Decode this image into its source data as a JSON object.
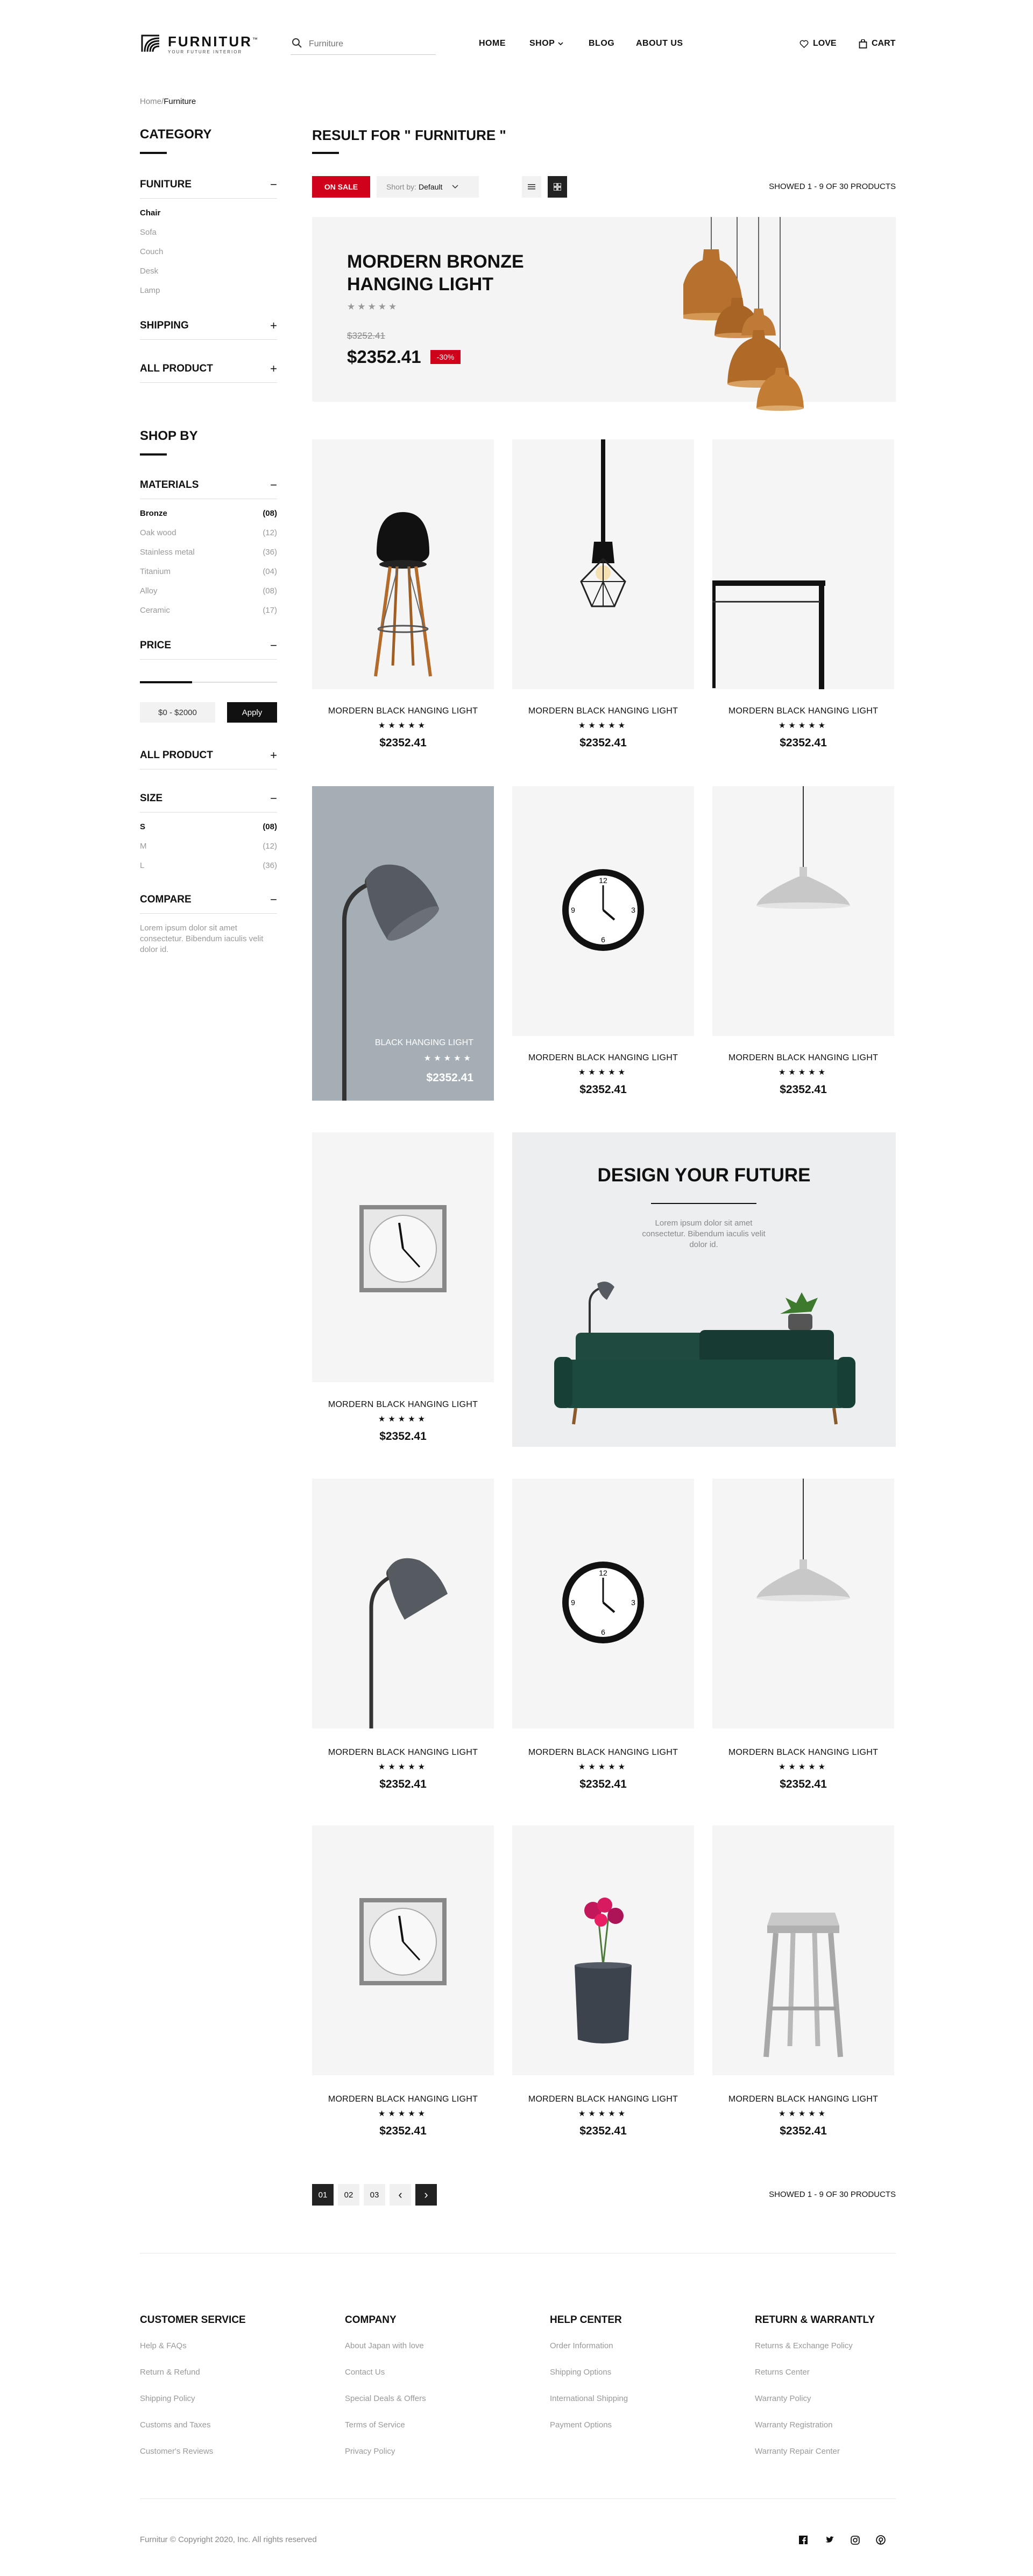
{
  "header": {
    "brand": "FURNITUR",
    "brand_mark": "™",
    "tagline": "YOUR FUTURE INTERIOR",
    "search_placeholder": "Furniture",
    "nav": [
      "HOME",
      "SHOP",
      "BLOG",
      "ABOUT US"
    ],
    "love_label": "LOVE",
    "cart_label": "CART"
  },
  "breadcrumb": {
    "home": "Home",
    "sep": "/",
    "current": "Furniture"
  },
  "sidebar": {
    "category_title": "CATEGORY",
    "funiture_group": "FUNITURE",
    "funiture_items": [
      "Chair",
      "Sofa",
      "Couch",
      "Desk",
      "Lamp"
    ],
    "shipping_group": "SHIPPING",
    "allproduct_group": "ALL PRODUCT",
    "shopby_title": "SHOP BY",
    "materials_group": "MATERIALS",
    "materials": [
      {
        "name": "Bronze",
        "count": "(08)"
      },
      {
        "name": "Oak wood",
        "count": "(12)"
      },
      {
        "name": "Stainless metal",
        "count": "(36)"
      },
      {
        "name": "Titanium",
        "count": "(04)"
      },
      {
        "name": "Alloy",
        "count": "(08)"
      },
      {
        "name": "Ceramic",
        "count": "(17)"
      }
    ],
    "price_group": "PRICE",
    "price_level": 0.38,
    "price_range": "$0 - $2000",
    "apply_label": "Apply",
    "allproduct_group2": "ALL PRODUCT",
    "size_group": "SIZE",
    "sizes": [
      {
        "name": "S",
        "count": "(08)"
      },
      {
        "name": "M",
        "count": "(12)"
      },
      {
        "name": "L",
        "count": "(36)"
      }
    ],
    "compare_group": "COMPARE",
    "compare_text": "Lorem ipsum dolor sit amet consectetur. Bibendum iaculis velit dolor id."
  },
  "results": {
    "title": "RESULT FOR \" FURNITURE \"",
    "on_sale": "ON SALE",
    "sort_prefix": "Short by:",
    "sort_value": "Default",
    "showed": "SHOWED 1 - 9 OF 30 PRODUCTS"
  },
  "promo": {
    "title": "MORDERN BRONZE HANGING LIGHT",
    "stars": "★★★★★",
    "old_price": "$3252.41",
    "price": "$2352.41",
    "discount": "-30%"
  },
  "product": {
    "name": "MORDERN BLACK HANGING LIGHT",
    "stars": "★★★★★",
    "price": "$2352.41"
  },
  "featured": {
    "name": "BLACK HANGING LIGHT",
    "stars": "★★★★★",
    "price": "$2352.41"
  },
  "design": {
    "title": "DESIGN YOUR FUTURE",
    "text": "Lorem ipsum dolor sit amet consectetur. Bibendum iaculis velit dolor id."
  },
  "pagination": {
    "pages": [
      "01",
      "02",
      "03"
    ],
    "prev": "‹",
    "next": "›",
    "showed": "SHOWED 1 - 9 OF 30 PRODUCTS"
  },
  "footer": {
    "columns": [
      {
        "title": "CUSTOMER SERVICE",
        "links": [
          "Help & FAQs",
          "Return & Refund",
          "Shipping Policy",
          "Customs and Taxes",
          "Customer's Reviews"
        ]
      },
      {
        "title": "COMPANY",
        "links": [
          "About Japan with love",
          "Contact Us",
          "Special Deals & Offers",
          "Terms of Service",
          "Privacy Policy"
        ]
      },
      {
        "title": "HELP CENTER",
        "links": [
          "Order Information",
          "Shipping Options",
          "International Shipping",
          "Payment Options"
        ]
      },
      {
        "title": "RETURN & WARRANTLY",
        "links": [
          "Returns & Exchange Policy",
          "Returns Center",
          "Warranty Policy",
          "Warranty Registration",
          "Warranty Repair Center"
        ]
      }
    ],
    "copyright": "Furnitur © Copyright 2020, Inc. All rights reserved",
    "social": [
      "facebook-icon",
      "twitter-icon",
      "instagram-icon",
      "pinterest-icon"
    ]
  },
  "colors": {
    "accent": "#d0021b",
    "dark": "#222222",
    "card_bg": "#f5f5f5"
  }
}
